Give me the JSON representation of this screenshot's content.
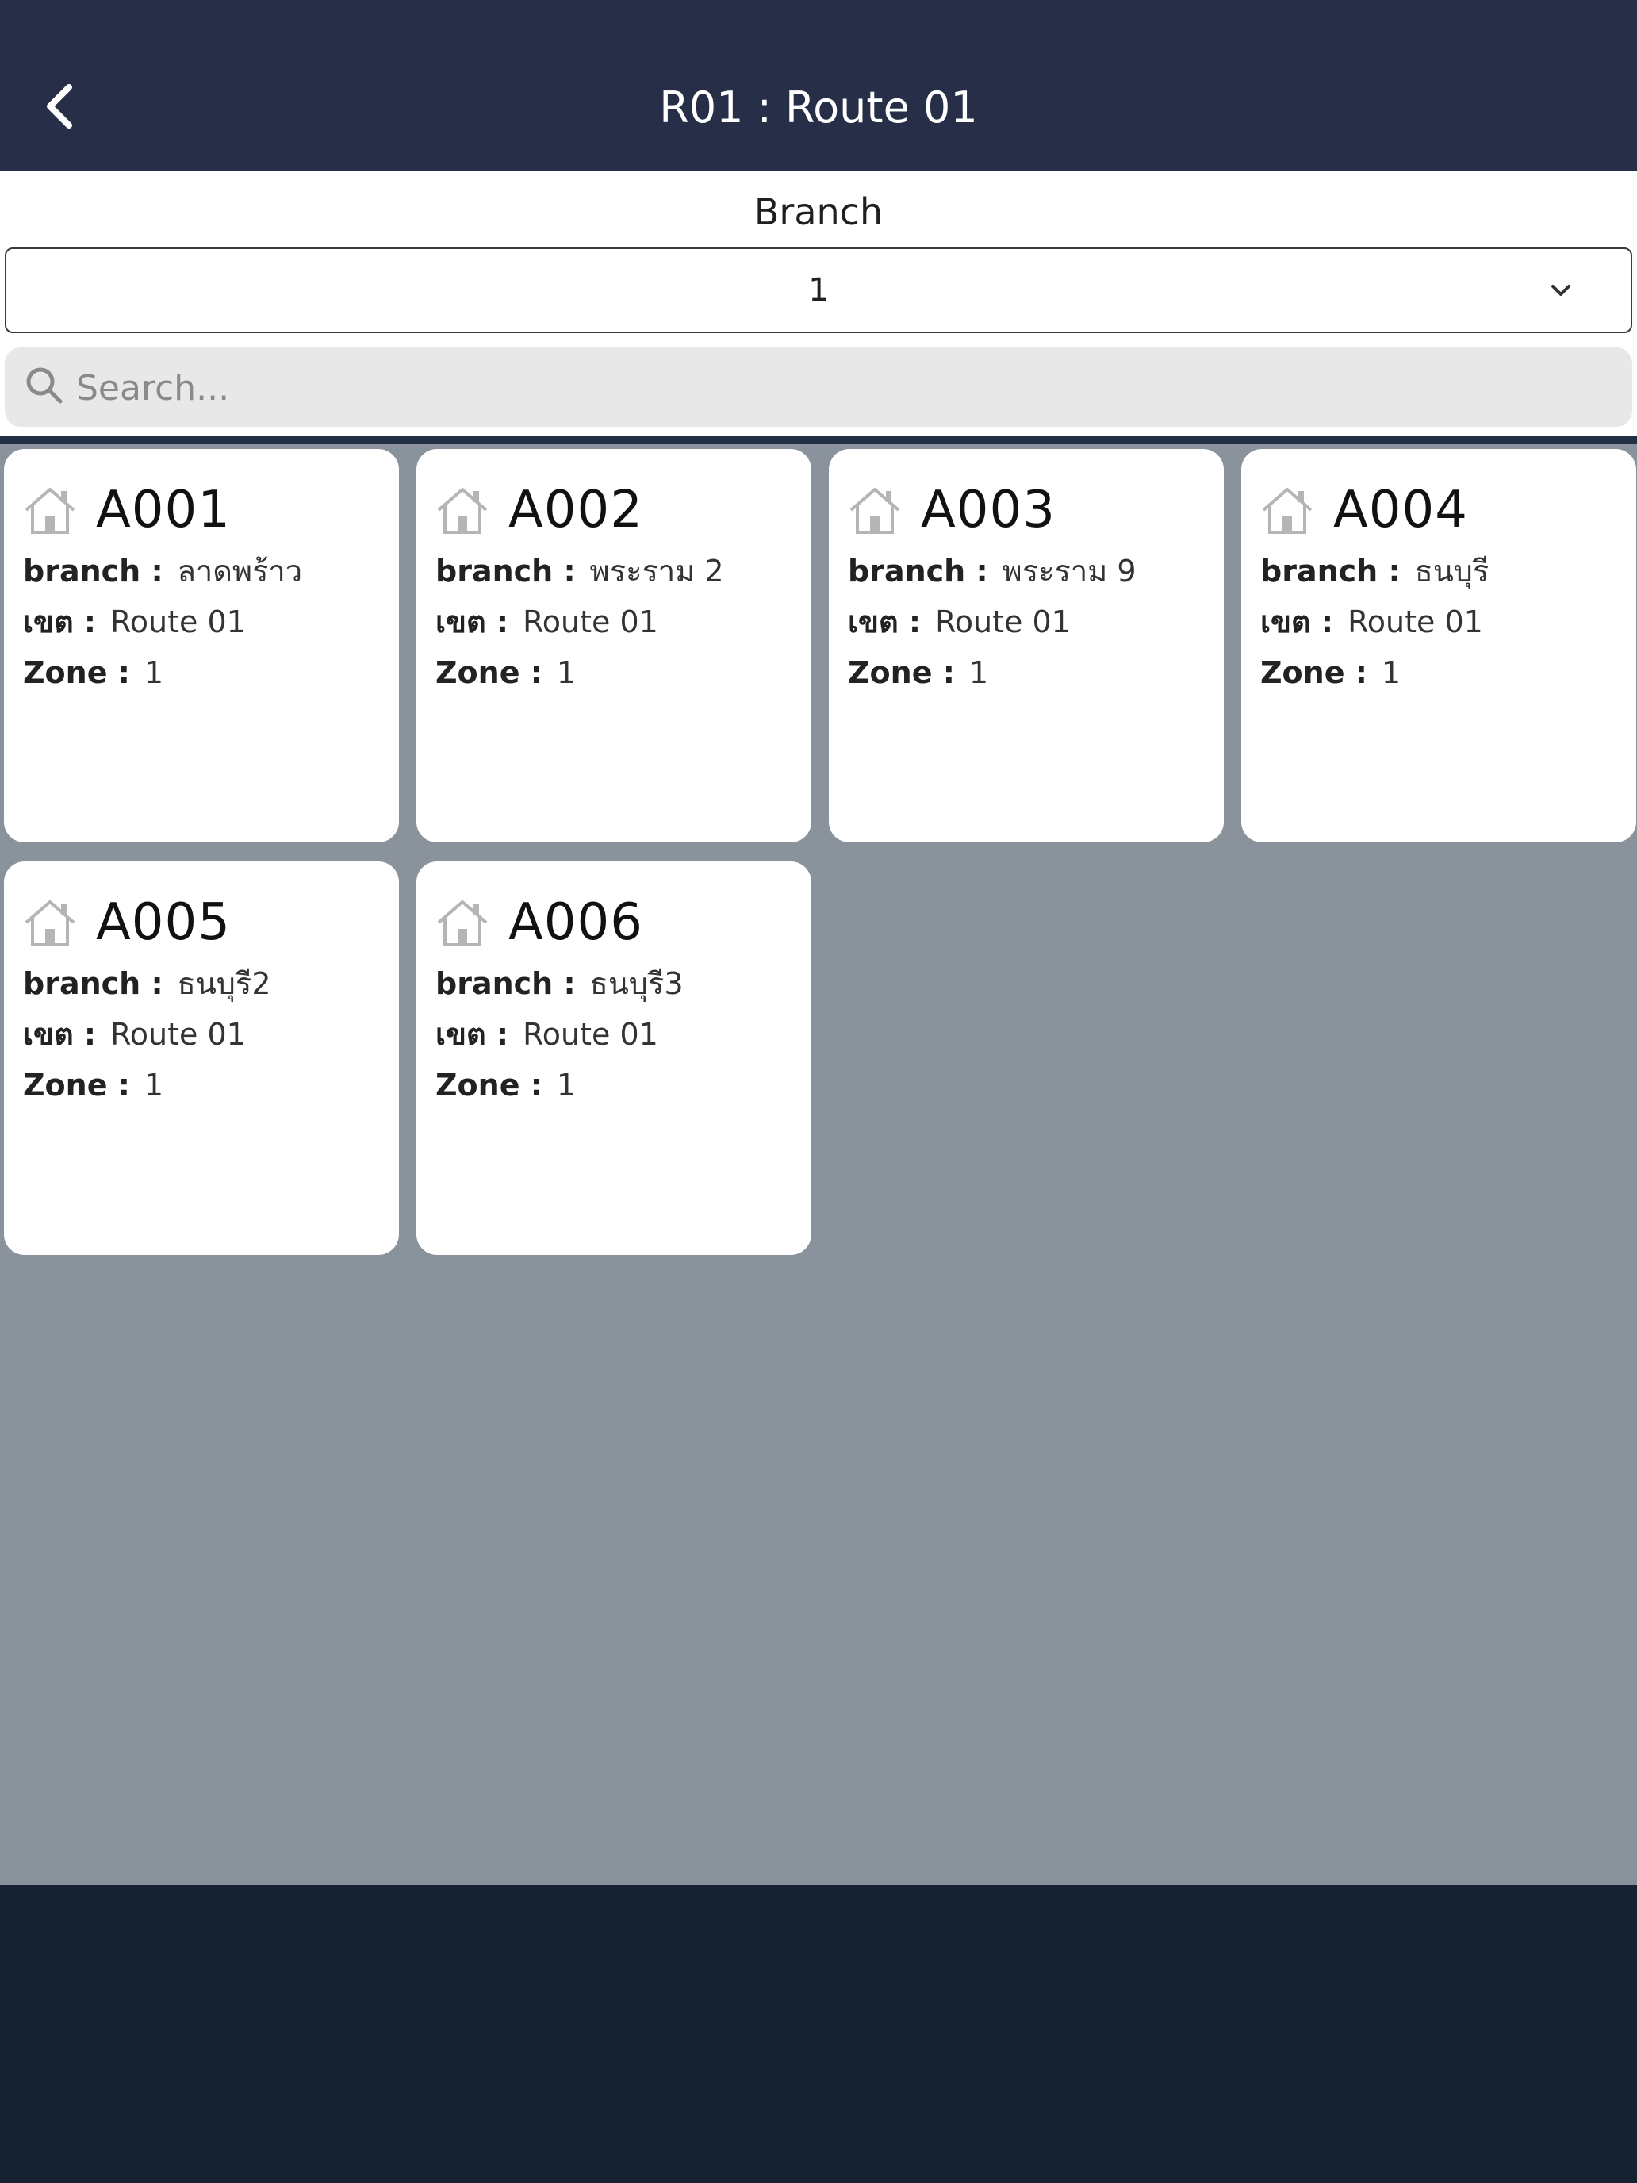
{
  "header": {
    "title": "R01 : Route 01"
  },
  "filter": {
    "branch_label": "Branch",
    "branch_value": "1",
    "search_placeholder": "Search..."
  },
  "icons": {
    "back": "chevron-left-icon",
    "dropdown": "chevron-down-icon",
    "search": "search-icon",
    "card": "house-icon"
  },
  "colors": {
    "header_bg": "#262e48",
    "content_bg": "#8a939b",
    "footer_bg": "#16222f",
    "card_bg": "#ffffff"
  },
  "field_labels": {
    "branch": "branch :",
    "zone_area": "เขต :",
    "zone": "Zone :"
  },
  "cards": [
    {
      "code": "A001",
      "branch": "ลาดพร้าว",
      "area": "Route 01",
      "zone": "1"
    },
    {
      "code": "A002",
      "branch": "พระราม 2",
      "area": "Route 01",
      "zone": "1"
    },
    {
      "code": "A003",
      "branch": "พระราม 9",
      "area": "Route 01",
      "zone": "1"
    },
    {
      "code": "A004",
      "branch": "ธนบุรี",
      "area": "Route 01",
      "zone": "1"
    },
    {
      "code": "A005",
      "branch": "ธนบุรี2",
      "area": "Route 01",
      "zone": "1"
    },
    {
      "code": "A006",
      "branch": "ธนบุรี3",
      "area": "Route 01",
      "zone": "1"
    }
  ]
}
